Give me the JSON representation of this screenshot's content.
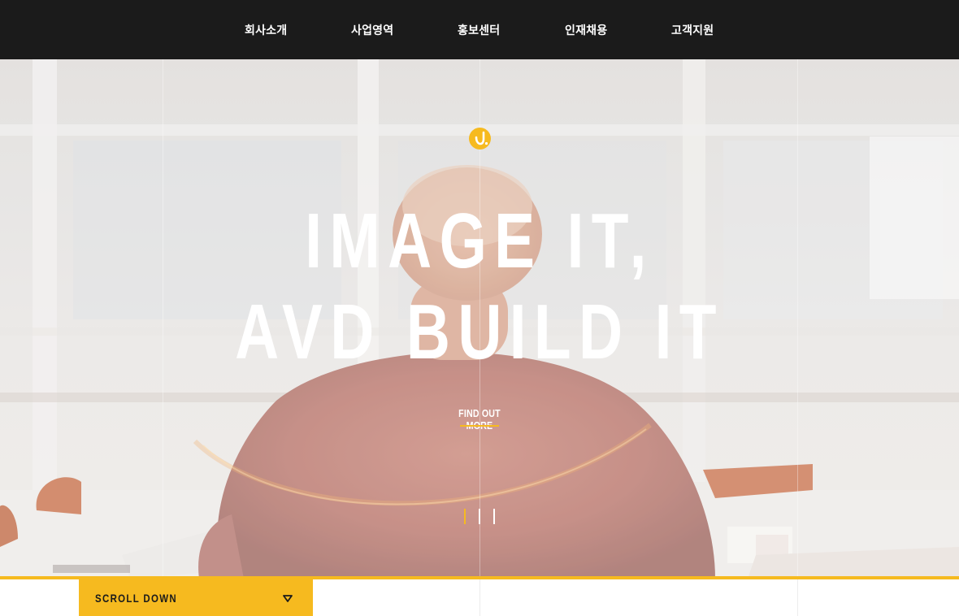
{
  "nav": {
    "items": [
      {
        "label": "회사소개"
      },
      {
        "label": "사업영역"
      },
      {
        "label": "홍보센터"
      },
      {
        "label": "인재채용"
      },
      {
        "label": "고객지원"
      }
    ]
  },
  "hero": {
    "title_line1": "IMAGE IT,",
    "title_line2": "AVD BUILD IT",
    "cta_label": "FIND OUT MORE",
    "slides_total": 3,
    "active_slide": 1,
    "logo_icon": "brand-logo-icon"
  },
  "scroll": {
    "label": "SCROLL DOWN",
    "icon": "triangle-down-icon"
  },
  "colors": {
    "accent": "#f6ba1f",
    "nav_bg": "#1b1b1b",
    "text_light": "#ffffff"
  }
}
